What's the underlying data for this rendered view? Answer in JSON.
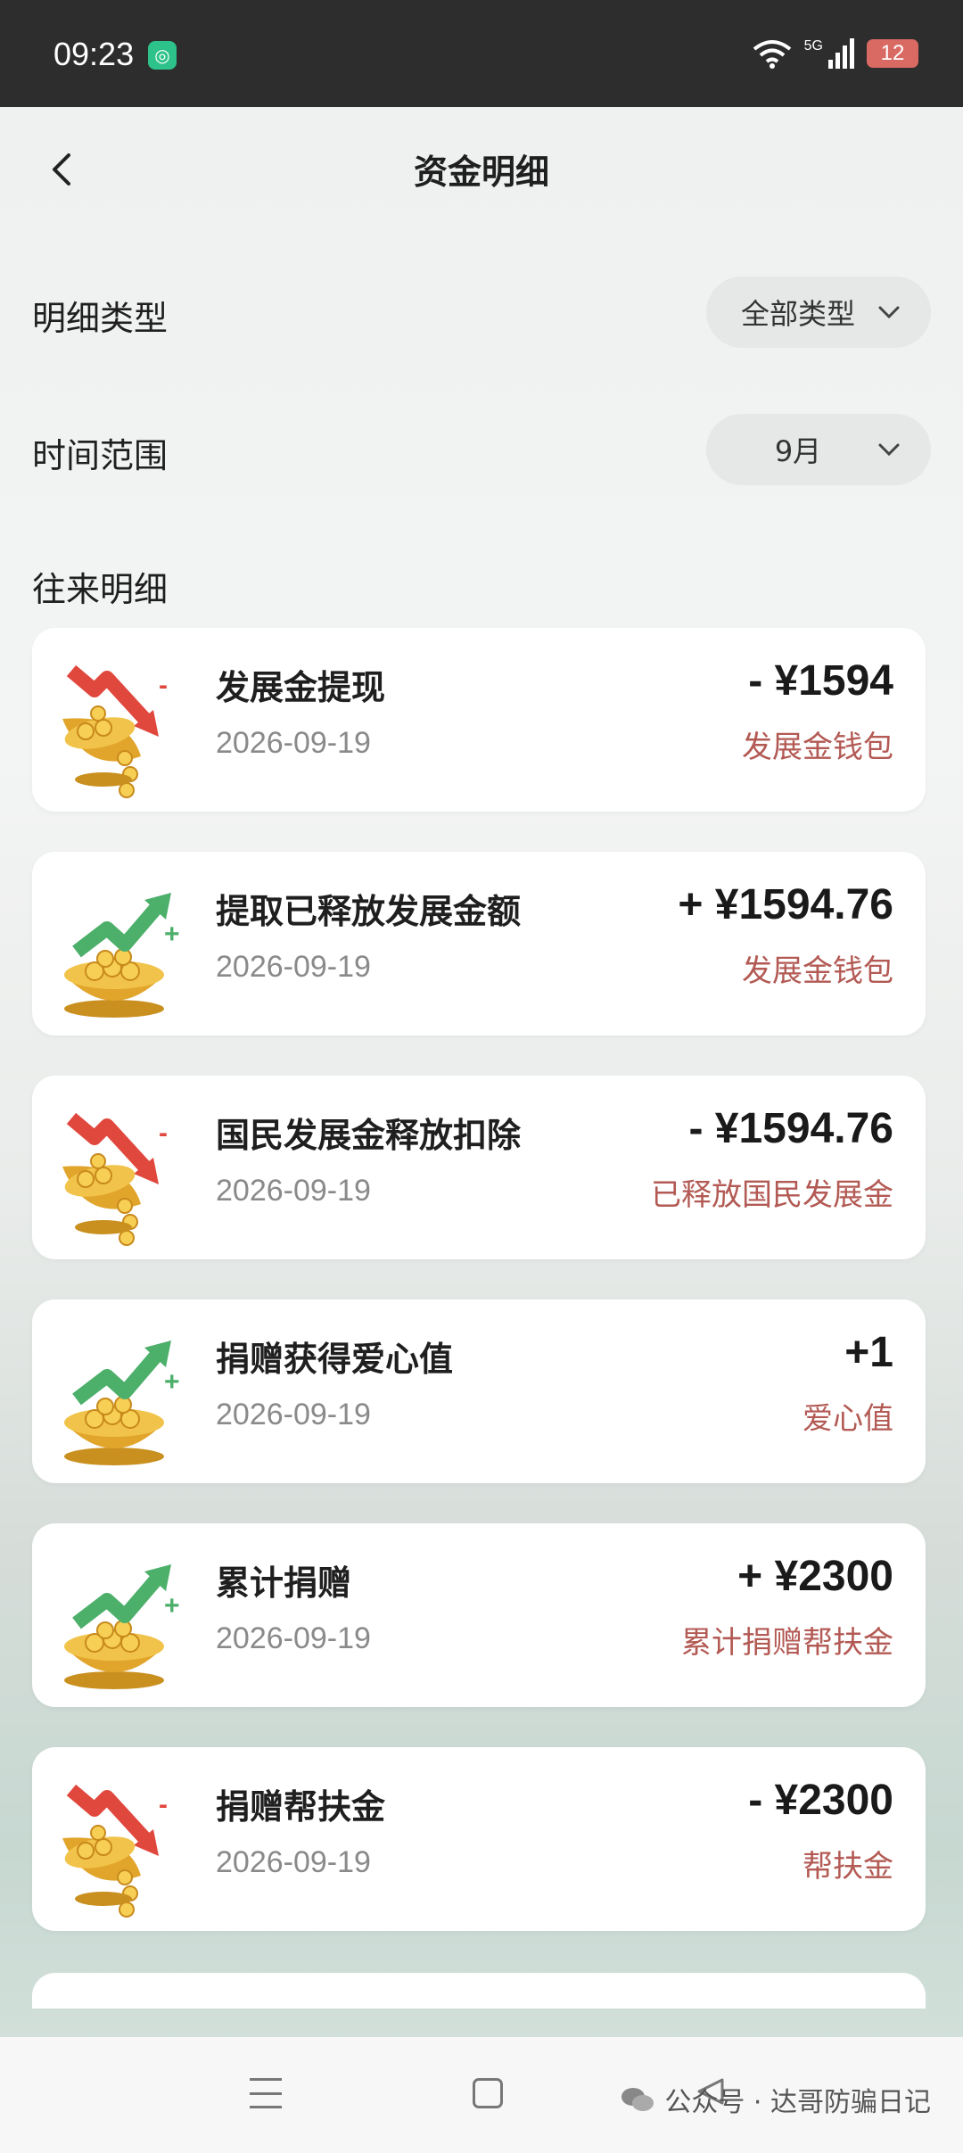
{
  "status_bar": {
    "time": "09:23",
    "network": "5G",
    "battery": "12"
  },
  "header": {
    "title": "资金明细"
  },
  "filters": [
    {
      "label": "明细类型",
      "value": "全部类型"
    },
    {
      "label": "时间范围",
      "value": "9月"
    }
  ],
  "section_title": "往来明细",
  "transactions": [
    {
      "title": "发展金提现",
      "date": "2026-09-19",
      "amount": "- ¥1594",
      "wallet": "发展金钱包",
      "direction": "down"
    },
    {
      "title": "提取已释放发展金额",
      "date": "2026-09-19",
      "amount": "+ ¥1594.76",
      "wallet": "发展金钱包",
      "direction": "up"
    },
    {
      "title": "国民发展金释放扣除",
      "date": "2026-09-19",
      "amount": "- ¥1594.76",
      "wallet": "已释放国民发展金",
      "direction": "down"
    },
    {
      "title": "捐赠获得爱心值",
      "date": "2026-09-19",
      "amount": "+1",
      "wallet": "爱心值",
      "direction": "up"
    },
    {
      "title": "累计捐赠",
      "date": "2026-09-19",
      "amount": "+ ¥2300",
      "wallet": "累计捐赠帮扶金",
      "direction": "up"
    },
    {
      "title": "捐赠帮扶金",
      "date": "2026-09-19",
      "amount": "- ¥2300",
      "wallet": "帮扶金",
      "direction": "down"
    }
  ],
  "watermark": "公众号 · 达哥防骗日记",
  "colors": {
    "up_arrow": "#4caf6a",
    "down_arrow": "#e0473d",
    "wallet_text": "#b35a54"
  }
}
